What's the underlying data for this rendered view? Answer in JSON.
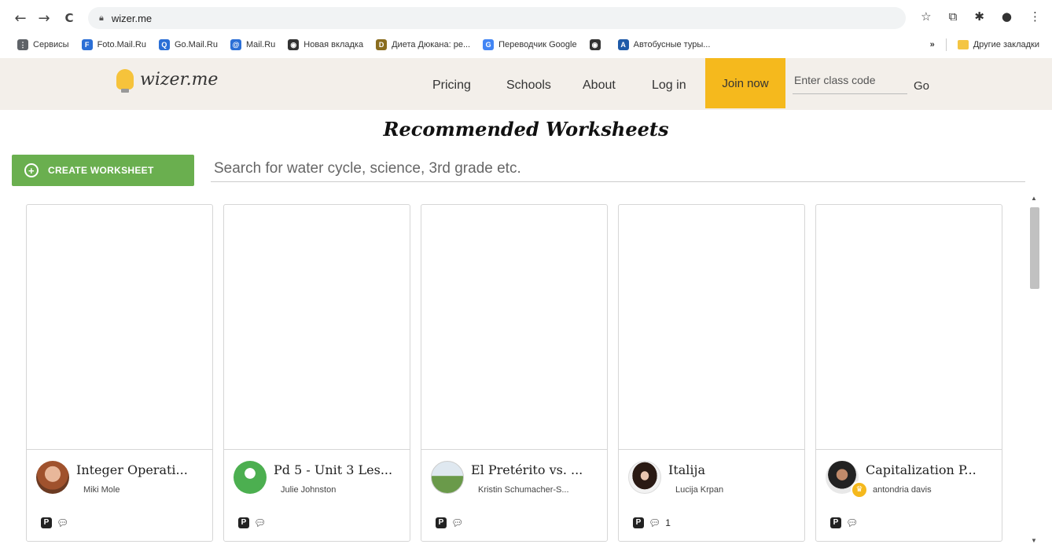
{
  "browser": {
    "back_icon": "←",
    "forward_icon": "→",
    "reload_icon": "C",
    "url": "wizer.me",
    "bookmarks": [
      {
        "label": "Сервисы",
        "color": "#5f6368",
        "glyph": "⋮"
      },
      {
        "label": "Foto.Mail.Ru",
        "color": "#2b6fd6",
        "glyph": "F"
      },
      {
        "label": "Go.Mail.Ru",
        "color": "#2b6fd6",
        "glyph": "Q"
      },
      {
        "label": "Mail.Ru",
        "color": "#2b6fd6",
        "glyph": "@"
      },
      {
        "label": "Новая вкладка",
        "color": "#333333",
        "glyph": "◉"
      },
      {
        "label": "Диета Дюкана: ре...",
        "color": "#8a6d1f",
        "glyph": "D"
      },
      {
        "label": "Переводчик Google",
        "color": "#4285f4",
        "glyph": "G"
      },
      {
        "label": "",
        "color": "#333333",
        "glyph": "◉"
      },
      {
        "label": "Автобусные туры...",
        "color": "#1e5aa8",
        "glyph": "A"
      }
    ],
    "more_bookmarks": "»",
    "other_bookmarks": "Другие закладки"
  },
  "site": {
    "logo_text": "wizer.me",
    "nav": {
      "pricing": "Pricing",
      "schools": "Schools",
      "about": "About",
      "login": "Log in",
      "join": "Join now"
    },
    "class_code_placeholder": "Enter class code",
    "go": "Go",
    "accent_color": "#f5b91d"
  },
  "main": {
    "title": "Recommended Worksheets",
    "create_button": "CREATE WORKSHEET",
    "search_placeholder": "Search for water cycle, science, 3rd grade etc.",
    "cards": [
      {
        "title": "Integer Operati...",
        "author": "Miki Mole",
        "comments": ""
      },
      {
        "title": "Pd 5 - Unit 3 Les...",
        "author": "Julie Johnston",
        "comments": ""
      },
      {
        "title": "El Pretérito vs. ...",
        "author": "Kristin Schumacher-S...",
        "comments": ""
      },
      {
        "title": "Italija",
        "author": "Lucija Krpan",
        "comments": "1"
      },
      {
        "title": "Capitalization P...",
        "author": "antondria davis",
        "comments": ""
      }
    ]
  }
}
